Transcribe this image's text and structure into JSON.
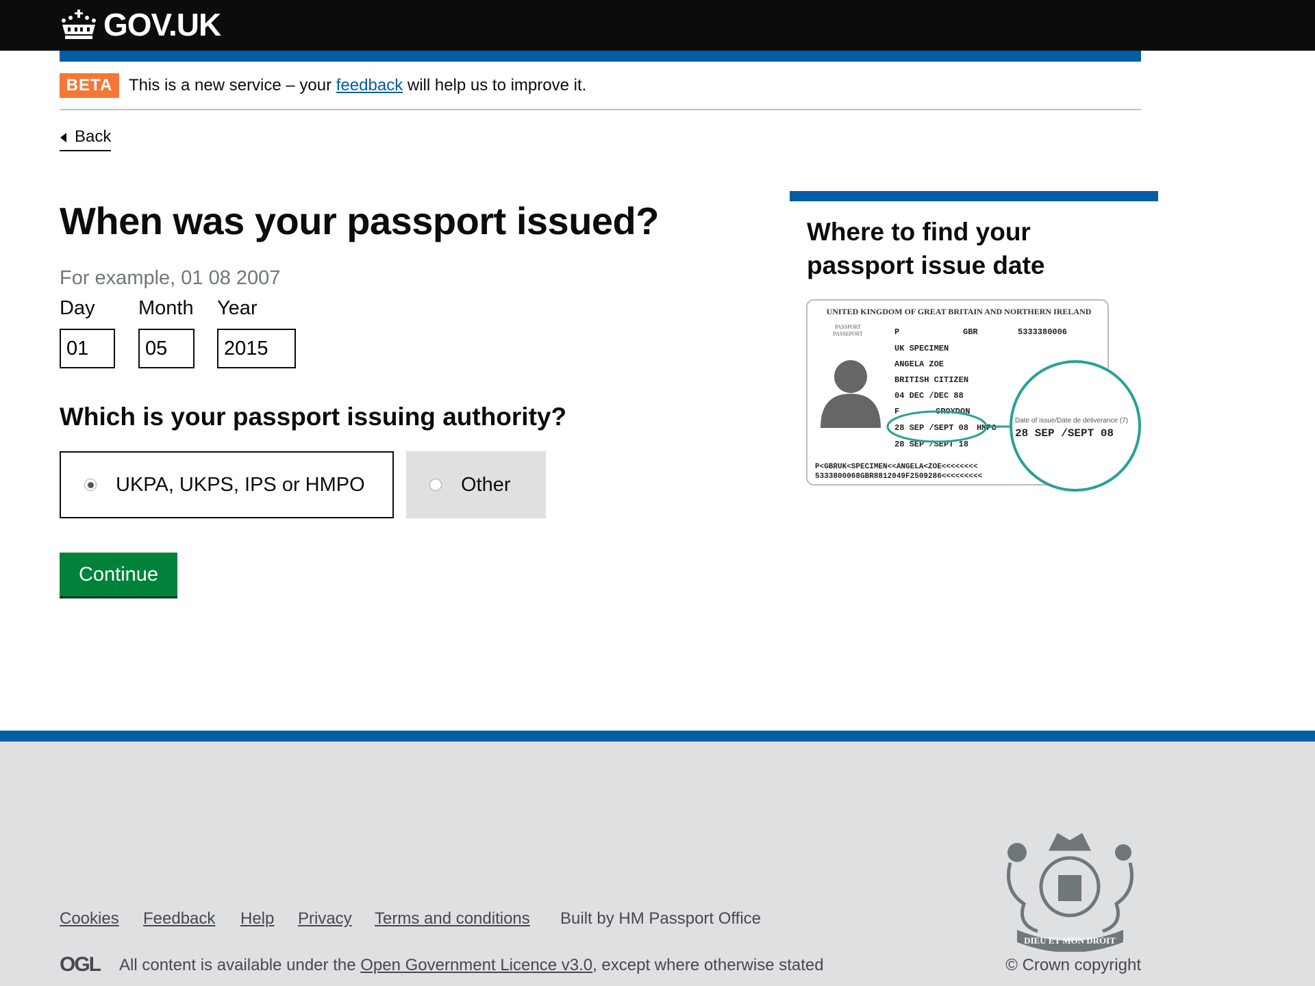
{
  "header": {
    "logo_text": "GOV.UK"
  },
  "phase_banner": {
    "tag": "BETA",
    "text_before": "This is a new service – your ",
    "link": "feedback",
    "text_after": " will help us to improve it."
  },
  "back_link": "Back",
  "question": {
    "title": "When was your passport issued?",
    "hint": "For example, 01 08 2007",
    "day_label": "Day",
    "month_label": "Month",
    "year_label": "Year",
    "day_value": "01",
    "month_value": "05",
    "year_value": "2015"
  },
  "authority": {
    "title": "Which is your passport issuing authority?",
    "options": [
      {
        "label": "UKPA, UKPS, IPS or HMPO",
        "selected": true
      },
      {
        "label": "Other",
        "selected": false
      }
    ]
  },
  "continue_label": "Continue",
  "sidebar": {
    "title": "Where to find your passport issue date",
    "passport": {
      "country": "UNITED KINGDOM OF GREAT BRITAIN AND NORTHERN IRELAND",
      "doc": "PASSPORT",
      "doc2": "PASSEPORT",
      "type": "P",
      "code": "GBR",
      "number": "5333380006",
      "surname": "UK SPECIMEN",
      "given": "ANGELA ZOE",
      "nationality": "BRITISH CITIZEN",
      "dob": "04 DEC /DEC 88",
      "sex": "F",
      "place": "CROYDON",
      "issue": "28 SEP /SEPT 08",
      "authority": "HMPO",
      "expiry": "28 SEP /SEPT 18",
      "mrz1": "P<GBRUK<SPECIMEN<<ANGELA<ZOE<<<<<<<<",
      "mrz2": "5333800068GBR8812049F2509286<<<<<<<<<",
      "zoom_label": "Date of issue/Date de deliverance (7)",
      "zoom_value": "28 SEP /SEPT 08",
      "highlight_color": "#28a197"
    }
  },
  "footer": {
    "links": [
      "Cookies",
      "Feedback",
      "Help",
      "Privacy",
      "Terms and conditions"
    ],
    "built_by": "Built by HM Passport Office",
    "ogl": "OGL",
    "licence_before": "All content is available under the ",
    "licence_link": "Open Government Licence v3.0",
    "licence_after": ", except where otherwise stated",
    "copyright": "© Crown copyright",
    "crest_text": "DIEU ET MON DROIT"
  }
}
